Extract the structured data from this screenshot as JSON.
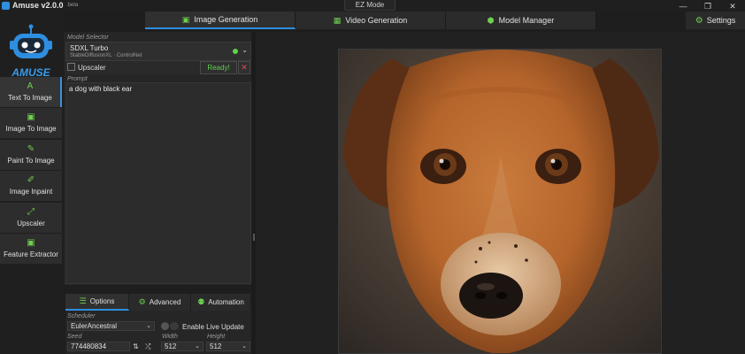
{
  "app": {
    "title": "Amuse v2.0.0",
    "beta": "beta",
    "logo_text": "AMUSE"
  },
  "window": {
    "minimize": "—",
    "restore": "❐",
    "close": "✕"
  },
  "ez_mode": "EZ Mode",
  "top_tabs": [
    {
      "label": "Image Generation",
      "icon": "image-icon",
      "active": true
    },
    {
      "label": "Video Generation",
      "icon": "film-icon",
      "active": false
    },
    {
      "label": "Model Manager",
      "icon": "cube-icon",
      "active": false
    }
  ],
  "settings": {
    "label": "Settings",
    "icon": "gear-icon"
  },
  "sidebar": {
    "items": [
      {
        "label": "Text To Image",
        "icon": "text-a-icon",
        "active": true
      },
      {
        "label": "Image To Image",
        "icon": "image-icon",
        "active": false
      },
      {
        "label": "Paint To Image",
        "icon": "brush-icon",
        "active": false
      },
      {
        "label": "Image Inpaint",
        "icon": "edit-icon",
        "active": false
      },
      {
        "label": "Upscaler",
        "icon": "expand-icon",
        "active": false
      },
      {
        "label": "Feature Extractor",
        "icon": "image-icon",
        "active": false
      }
    ]
  },
  "model_selector": {
    "label": "Model Selector",
    "model_name": "SDXL Turbo",
    "model_sub": "StableDiffusionXL · ControlNet",
    "status_color": "#5fd14a"
  },
  "upscaler": {
    "label": "Upscaler",
    "ready": "Ready!",
    "clear": "✕"
  },
  "prompt": {
    "label": "Prompt",
    "value": "a dog with black ear"
  },
  "sub_tabs": [
    {
      "label": "Options",
      "icon": "sliders-icon",
      "active": true
    },
    {
      "label": "Advanced",
      "icon": "gears-icon",
      "active": false
    },
    {
      "label": "Automation",
      "icon": "robot-icon",
      "active": false
    }
  ],
  "options": {
    "scheduler_label": "Scheduler",
    "scheduler_value": "EulerAncestral",
    "live_update_label": "Enable Live Update",
    "seed_label": "Seed",
    "seed_value": "774480834",
    "width_label": "Width",
    "width_value": "512",
    "height_label": "Height",
    "height_value": "512"
  },
  "colors": {
    "accent_green": "#6fd04f",
    "accent_blue": "#2e8ee0",
    "danger": "#e24b4b"
  }
}
